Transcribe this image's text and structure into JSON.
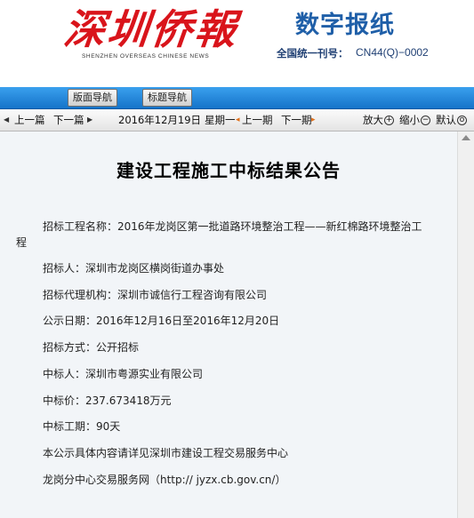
{
  "masthead": {
    "logo_cn": "深圳侨報",
    "logo_en": "SHENZHEN OVERSEAS CHINESE NEWS",
    "digital_title": "数字报纸",
    "cn_label": "全国统一刊号：",
    "cn_number": "CN44(Q)−0002"
  },
  "nav": {
    "page_nav": "版面导航",
    "title_nav": "标题导航"
  },
  "toolbar": {
    "prev_article": "上一篇",
    "next_article": "下一篇",
    "date": "2016年12月19日",
    "weekday": "星期一",
    "prev_issue": "上一期",
    "next_issue": "下一期",
    "zoom_in": "放大",
    "zoom_out": "缩小",
    "default": "默认"
  },
  "article": {
    "title": "建设工程施工中标结果公告",
    "project_line1": "招标工程名称：2016年龙岗区第一批道路环境整治工程——新红棉路环境整治工",
    "project_line2": "程",
    "bidder": "招标人：深圳市龙岗区横岗街道办事处",
    "agent": "招标代理机构：深圳市诚信行工程咨询有限公司",
    "period": "公示日期：2016年12月16日至2016年12月20日",
    "method": "招标方式：公开招标",
    "winner": "中标人：深圳市粤源实业有限公司",
    "price": "中标价：237.673418万元",
    "duration": "中标工期：90天",
    "note": "本公示具体内容请详见深圳市建设工程交易服务中心",
    "website": "龙岗分中心交易服务网（http:// jyzx.cb.gov.cn/）"
  },
  "colors": {
    "logo_red": "#d9141b",
    "digital_blue": "#1f5fa8",
    "nav_blue": "#1573c9",
    "content_bg": "#f2f5f8"
  }
}
